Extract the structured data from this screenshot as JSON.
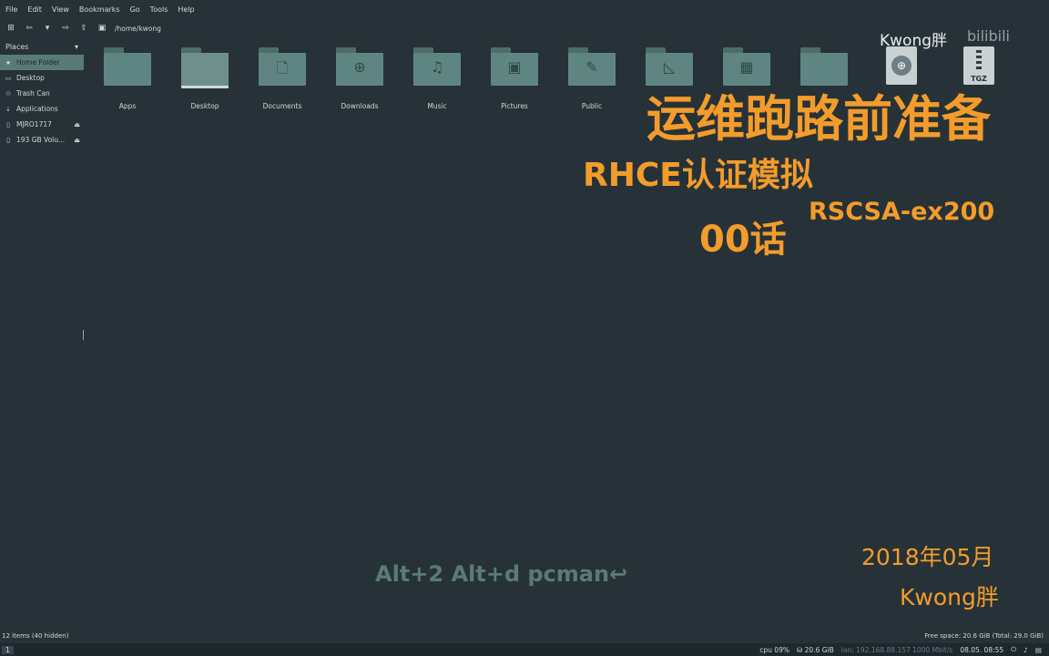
{
  "menu": [
    "File",
    "Edit",
    "View",
    "Bookmarks",
    "Go",
    "Tools",
    "Help"
  ],
  "toolbar": {
    "path": "/home/kwong",
    "buttons": [
      "new-tab-icon",
      "back-icon",
      "back-dropdown-icon",
      "forward-icon",
      "up-icon",
      "home-icon"
    ]
  },
  "sidebar": {
    "heading": "Places",
    "items": [
      {
        "label": "Home Folder",
        "icon": "home-icon",
        "selected": true
      },
      {
        "label": "Desktop",
        "icon": "desktop-icon"
      },
      {
        "label": "Trash Can",
        "icon": "trash-icon"
      },
      {
        "label": "Applications",
        "icon": "applications-icon"
      },
      {
        "label": "MJRO1717",
        "icon": "drive-icon",
        "eject": true
      },
      {
        "label": "193 GB Volu...",
        "icon": "drive-icon",
        "eject": true
      }
    ]
  },
  "files": [
    {
      "label": "Apps",
      "icon": "folder"
    },
    {
      "label": "Desktop",
      "icon": "desktop-folder"
    },
    {
      "label": "Documents",
      "icon": "documents-folder"
    },
    {
      "label": "Downloads",
      "icon": "downloads-folder"
    },
    {
      "label": "Music",
      "icon": "music-folder"
    },
    {
      "label": "Pictures",
      "icon": "pictures-folder"
    },
    {
      "label": "Public",
      "icon": "public-folder"
    },
    {
      "label": "",
      "icon": "templates-folder"
    },
    {
      "label": "",
      "icon": "videos-folder"
    },
    {
      "label": "",
      "icon": "folder"
    },
    {
      "label": "",
      "icon": "html-file"
    },
    {
      "label": "",
      "icon": "tgz-file",
      "badge": "TGZ"
    }
  ],
  "overlay": {
    "brand": "Kwong胖",
    "bilibili": "bilibili",
    "title": "运维跑路前准备",
    "subtitle": "RHCE认证模拟",
    "episode": "00话",
    "exam": "RSCSA-ex200",
    "command": "Alt+2 Alt+d pcman↩",
    "date": "2018年05月",
    "author": "Kwong胖"
  },
  "status": {
    "items": "12 items (40 hidden)",
    "free": "Free space: 20.6 GiB (Total: 29.0 GiB)"
  },
  "panel": {
    "workspace": "1",
    "cpu": "cpu  09%",
    "mem": "20.6 GiB",
    "net": "lan: 192.168.88.157 1000 Mbit/s",
    "time": "08.05. 08:55"
  },
  "colors": {
    "background": "#263238",
    "folder": "#5f8583",
    "overlay": "#f39c2b",
    "selected": "#5a7a78"
  }
}
